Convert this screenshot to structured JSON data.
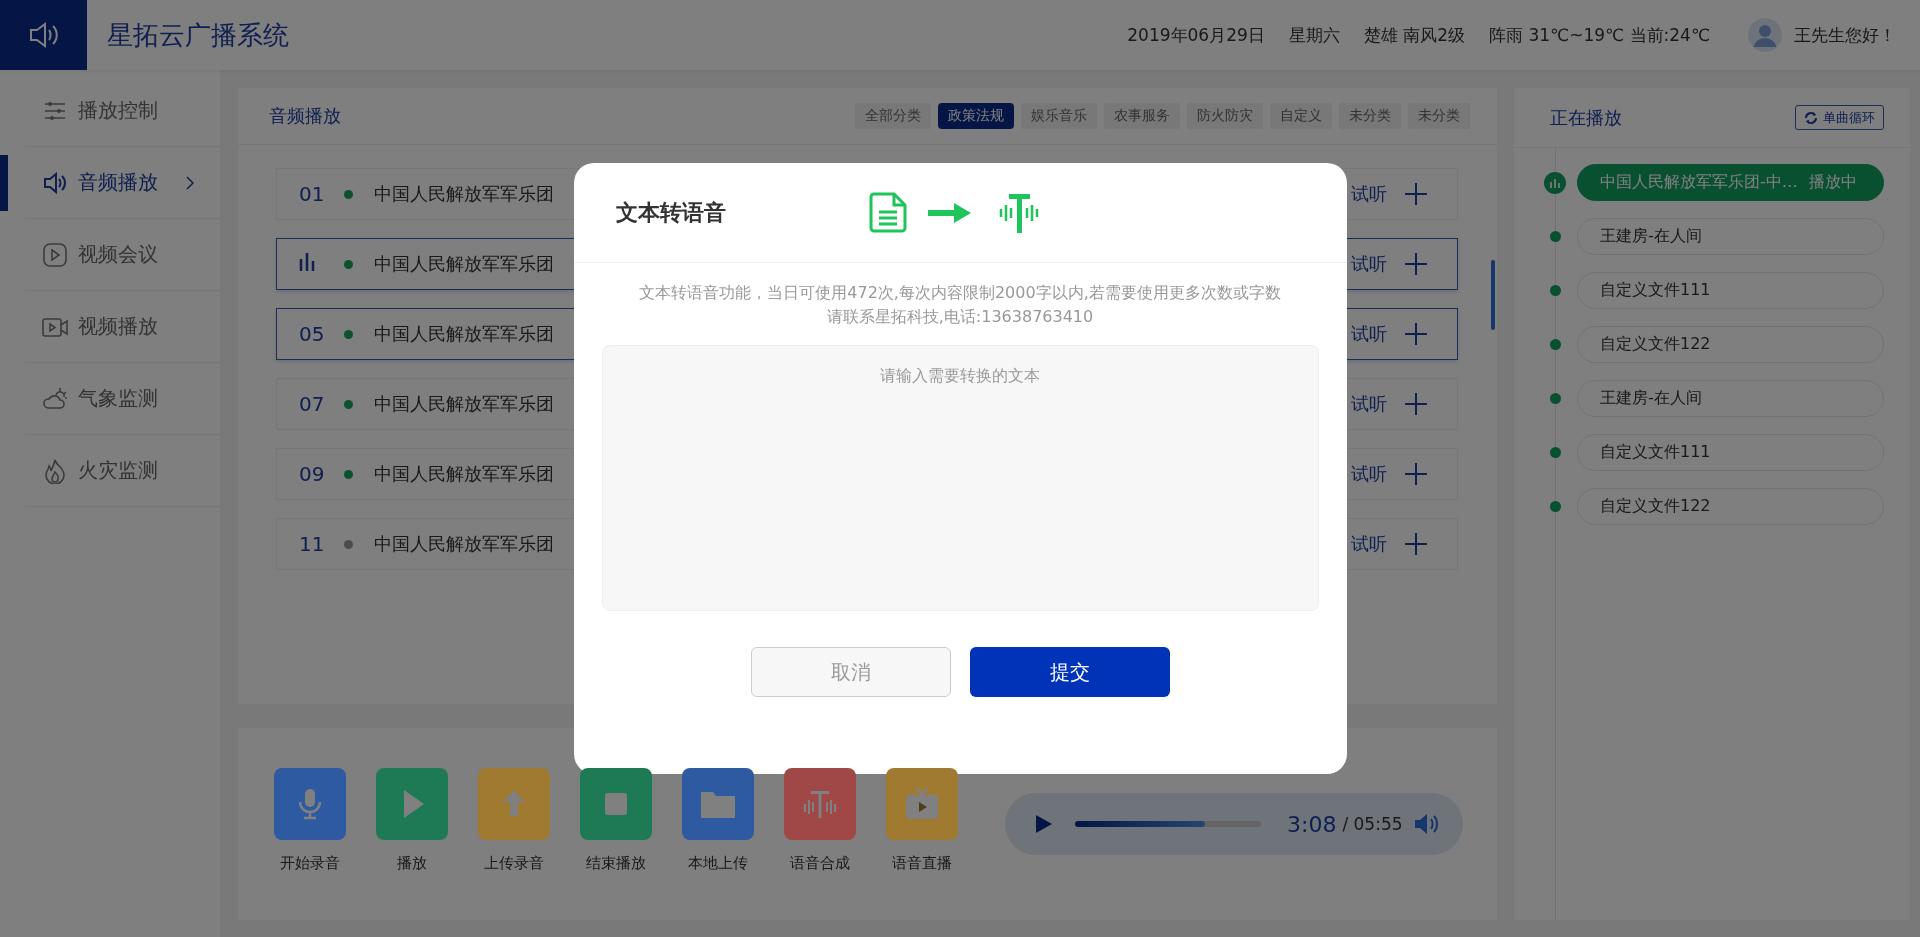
{
  "header": {
    "title": "星拓云广播系统",
    "date": "2019年06月29日",
    "weekday": "星期六",
    "wind": "楚雄 南风2级",
    "weather": "阵雨 31℃~19℃ 当前:24℃",
    "greeting": "王先生您好！"
  },
  "sidebar": {
    "items": [
      {
        "label": "播放控制",
        "kind": "controls",
        "selected": false
      },
      {
        "label": "音频播放",
        "kind": "audio",
        "selected": true
      },
      {
        "label": "视频会议",
        "kind": "meeting",
        "selected": false
      },
      {
        "label": "视频播放",
        "kind": "video",
        "selected": false
      },
      {
        "label": "气象监测",
        "kind": "weather",
        "selected": false
      },
      {
        "label": "火灾监测",
        "kind": "fire",
        "selected": false
      }
    ]
  },
  "audio_panel": {
    "title": "音频播放",
    "categories": [
      {
        "label": "全部分类",
        "selected": false
      },
      {
        "label": "政策法规",
        "selected": true
      },
      {
        "label": "娱乐音乐",
        "selected": false
      },
      {
        "label": "农事服务",
        "selected": false
      },
      {
        "label": "防火防灾",
        "selected": false
      },
      {
        "label": "自定义",
        "selected": false
      },
      {
        "label": "未分类",
        "selected": false
      },
      {
        "label": "未分类",
        "selected": false
      }
    ],
    "rows": [
      {
        "number": "01",
        "playing": false,
        "highlighted": false,
        "online": true,
        "title": "中国人民解放军军乐团",
        "action": "试听"
      },
      {
        "playing": true,
        "highlighted": true,
        "online": true,
        "title": "中国人民解放军军乐团",
        "action": "试听"
      },
      {
        "number": "05",
        "playing": false,
        "highlighted": true,
        "online": true,
        "title": "中国人民解放军军乐团",
        "action": "试听"
      },
      {
        "number": "07",
        "playing": false,
        "highlighted": false,
        "online": true,
        "title": "中国人民解放军军乐团",
        "action": "试听"
      },
      {
        "number": "09",
        "playing": false,
        "highlighted": false,
        "online": true,
        "title": "中国人民解放军军乐团",
        "action": "试听"
      },
      {
        "number": "11",
        "playing": false,
        "highlighted": false,
        "online": false,
        "title": "中国人民解放军军乐团",
        "action": "试听"
      }
    ]
  },
  "toolbar": {
    "tools": [
      {
        "label": "开始录音",
        "kind": "mic",
        "color": "#2d5aa0"
      },
      {
        "label": "播放",
        "kind": "play",
        "color": "#1e7a55"
      },
      {
        "label": "上传录音",
        "kind": "upload",
        "color": "#a07a30"
      },
      {
        "label": "结束播放",
        "kind": "stop",
        "color": "#1e7a55"
      },
      {
        "label": "本地上传",
        "kind": "folder",
        "color": "#2d5aa0"
      },
      {
        "label": "语音合成",
        "kind": "tts",
        "color": "#a04848"
      },
      {
        "label": "语音直播",
        "kind": "tv",
        "color": "#a07a30"
      }
    ]
  },
  "player": {
    "elapsed": "3:08",
    "total": "/ 05:55",
    "level": 0.7
  },
  "now_playing": {
    "title": "正在播放",
    "loop_button": "单曲循环",
    "items": [
      {
        "title": "中国人民解放军军乐团-中…",
        "status": "播放中",
        "selected": true
      },
      {
        "title": "王建房-在人间",
        "selected": false
      },
      {
        "title": "自定义文件111",
        "selected": false
      },
      {
        "title": "自定义文件122",
        "selected": false
      },
      {
        "title": "王建房-在人间",
        "selected": false
      },
      {
        "title": "自定义文件111",
        "selected": false
      },
      {
        "title": "自定义文件122",
        "selected": false
      }
    ]
  },
  "dialog": {
    "title": "文本转语音",
    "notice_lines": [
      "文本转语音功能，当日可使用472次,每次内容限制2000字以内,若需要使用更多次数或字数",
      "请联系星拓科技,电话:13638763410"
    ],
    "placeholder": "请输入需要转换的文本",
    "buttons": [
      {
        "label": "取消",
        "kind": "secondary"
      },
      {
        "label": "提交",
        "kind": "primary"
      }
    ]
  }
}
